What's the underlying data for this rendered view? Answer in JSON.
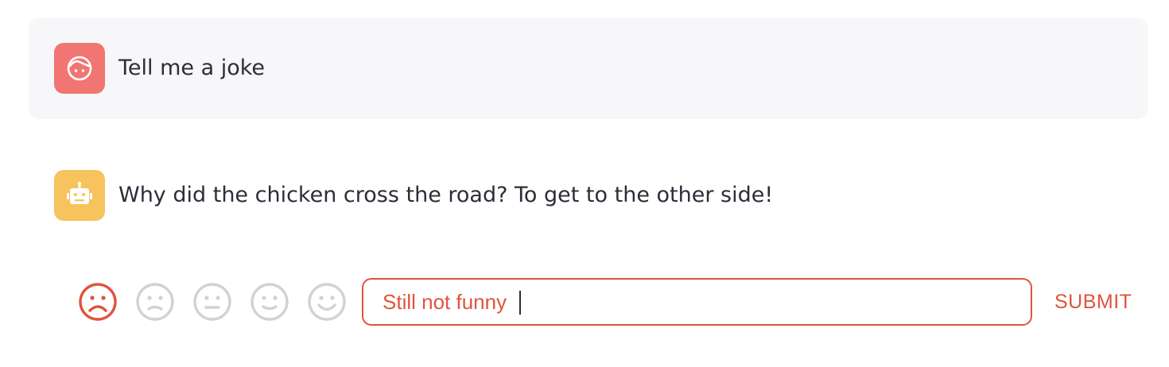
{
  "chat": {
    "messages": [
      {
        "role": "user",
        "avatar_icon": "user-face-icon",
        "avatar_color": "#f07573",
        "text": "Tell me a joke"
      },
      {
        "role": "assistant",
        "avatar_icon": "robot-icon",
        "avatar_color": "#f6c35c",
        "text": "Why did the chicken cross the road? To get to the other side!"
      }
    ]
  },
  "feedback": {
    "faces": [
      {
        "icon": "very-sad-face-icon",
        "selected": true
      },
      {
        "icon": "sad-face-icon",
        "selected": false
      },
      {
        "icon": "neutral-face-icon",
        "selected": false
      },
      {
        "icon": "slight-smile-face-icon",
        "selected": false
      },
      {
        "icon": "happy-face-icon",
        "selected": false
      }
    ],
    "selected_color": "#e0533d",
    "unselected_color": "#cfd3d6",
    "input_value": "Still not funny",
    "submit_label": "SUBMIT"
  }
}
